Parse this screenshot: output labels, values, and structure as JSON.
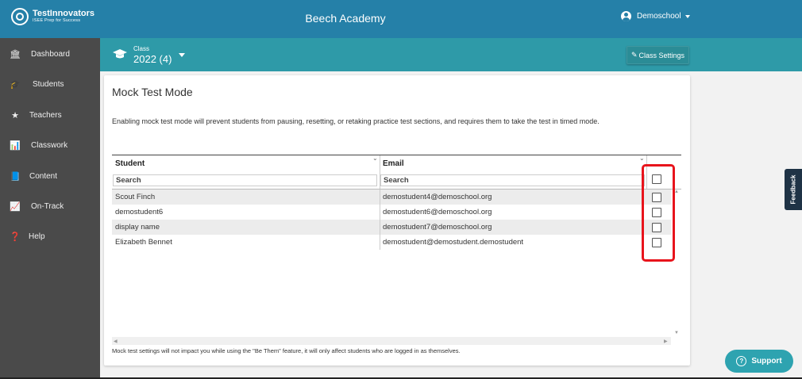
{
  "brand": {
    "name": "TestInnovators",
    "tagline": "ISEE Prep for Success"
  },
  "header": {
    "title": "Beech Academy",
    "user": "Demoschool"
  },
  "sidebar": {
    "items": [
      {
        "label": "Dashboard",
        "icon": "bank-icon"
      },
      {
        "label": "Students",
        "icon": "graduation-cap-icon"
      },
      {
        "label": "Teachers",
        "icon": "star-icon"
      },
      {
        "label": "Classwork",
        "icon": "bar-chart-icon"
      },
      {
        "label": "Content",
        "icon": "book-icon"
      },
      {
        "label": "On-Track",
        "icon": "line-chart-icon"
      },
      {
        "label": "Help",
        "icon": "question-icon"
      }
    ]
  },
  "class_bar": {
    "label": "Class",
    "value": "2022 (4)",
    "settings_label": "Class Settings"
  },
  "card": {
    "title": "Mock Test Mode",
    "description": "Enabling mock test mode will prevent students from pausing, resetting, or retaking practice test sections, and requires them to take the test in timed mode.",
    "footer": "Mock test settings will not impact you while using the \"Be Them\" feature, it will only affect students who are logged in as themselves."
  },
  "grid": {
    "columns": [
      "Student",
      "Email"
    ],
    "search_placeholder": "Search",
    "rows": [
      {
        "student": "Scout Finch",
        "email": "demostudent4@demoschool.org",
        "checked": false
      },
      {
        "student": "demostudent6",
        "email": "demostudent6@demoschool.org",
        "checked": false
      },
      {
        "student": "display name",
        "email": "demostudent7@demoschool.org",
        "checked": false
      },
      {
        "student": "Elizabeth Bennet",
        "email": "demostudent@demostudent.demostudent",
        "checked": false
      }
    ],
    "select_all_checked": false
  },
  "widgets": {
    "feedback_label": "Feedback",
    "support_label": "Support"
  },
  "colors": {
    "topbar": "#2580a8",
    "class_bar": "#2e9aa8",
    "sidebar": "#4a4a4a",
    "highlight": "#e8141c",
    "support": "#2ea3b0"
  }
}
